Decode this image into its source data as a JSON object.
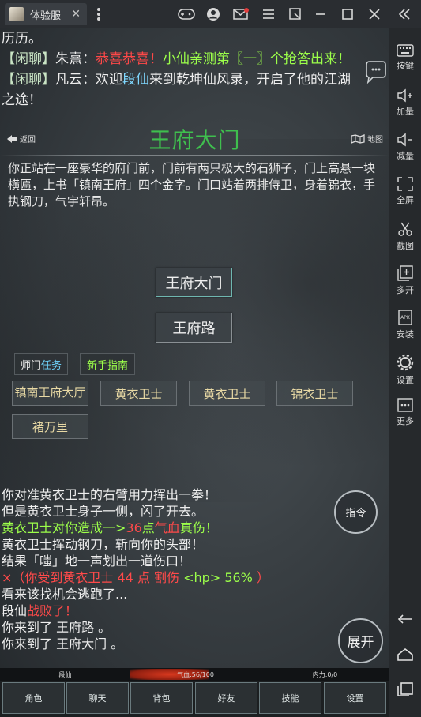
{
  "window": {
    "tab_title": "体验服",
    "tab_close": "✕"
  },
  "sidebar": {
    "items": [
      {
        "label": "按键"
      },
      {
        "label": "加量"
      },
      {
        "label": "减量"
      },
      {
        "label": "全屏"
      },
      {
        "label": "截图"
      },
      {
        "label": "多开"
      },
      {
        "label": "安装"
      },
      {
        "label": "设置"
      },
      {
        "label": "更多"
      }
    ]
  },
  "chat": {
    "line0": "历历。",
    "line1_tag": "【闲聊】",
    "line1_name": "朱熹：",
    "line1_red": "恭喜恭喜！",
    "line1_green": "小仙亲测第〖一〗个抢答出来！",
    "line2_tag": "【闲聊】",
    "line2_name": "凡云：",
    "line2_a": "欢迎",
    "line2_link": "段仙",
    "line2_b": "来到乾坤仙风录，开启了他的江湖",
    "line3": "之途！"
  },
  "scene": {
    "back_label": "返回",
    "map_label": "地图",
    "title": "王府大门",
    "description": "你正站在一座豪华的府门前，门前有两只极大的石狮子，门上高悬一块横匾，上书「镇南王府」四个金字。门口站着两排侍卫，身着锦衣，手执钢刀，气宇轩昂。"
  },
  "map": {
    "current_room": "王府大门",
    "south_room": "王府路"
  },
  "actions": {
    "master_task_a": "师门",
    "master_task_b": "任务",
    "newbie_guide": "新手指南"
  },
  "npcs": [
    {
      "name": "镇南王府大厅"
    },
    {
      "name": "黄衣卫士"
    },
    {
      "name": "黄衣卫士"
    },
    {
      "name": "锦衣卫士"
    },
    {
      "name": "褚万里"
    }
  ],
  "log": {
    "l1": "你对准黄衣卫士的右臂用力挥出一拳！",
    "l2": "但是黄衣卫士身子一侧，闪了开去。",
    "l3a": "黄衣卫士对你造成一>",
    "l3b": "36",
    "l3c": "点",
    "l3d": "气血",
    "l3e": "真伤！",
    "l4": "黄衣卫士挥动钢刀，斩向你的头部！",
    "l5": "结果「嗤」地一声划出一道伤口！",
    "l6a": "×（你受到黄衣卫士 44 点 割伤",
    "l6b": "<hp> 56%",
    "l6c": "）",
    "l7": "看来该找机会逃跑了...",
    "l8a": "段仙",
    "l8b": "战败了！",
    "l9": "你来到了 王府路 。",
    "l10": "你来到了 王府大门 。"
  },
  "round_buttons": {
    "command": "指令",
    "expand": "展开"
  },
  "status": {
    "name": "段仙",
    "qi": "气血:56/100",
    "qi_value": 0.56,
    "neili": "内力:0/0"
  },
  "bottom_bar": [
    {
      "label": "角色"
    },
    {
      "label": "聊天"
    },
    {
      "label": "背包"
    },
    {
      "label": "好友"
    },
    {
      "label": "技能"
    },
    {
      "label": "设置"
    }
  ],
  "colors": {
    "title_green": "#3fbf4e",
    "chat_green": "#9cff4a",
    "alert_red": "#ff4848",
    "link_blue": "#7fd8ff",
    "npc_gold": "#e8d9a4"
  }
}
